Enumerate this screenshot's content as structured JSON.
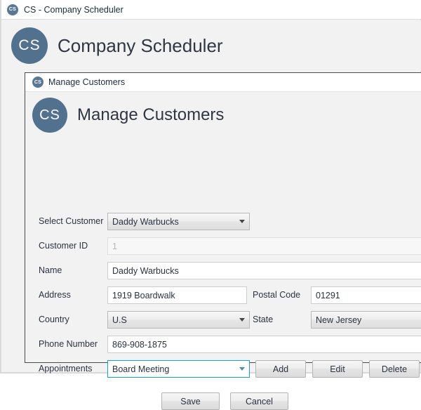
{
  "app_window": {
    "titlebar": {
      "icon": "cs-app-icon",
      "icon_text": "CS",
      "title": "CS - Company Scheduler"
    },
    "header": {
      "avatar_text": "CS",
      "heading": "Company Scheduler"
    }
  },
  "dialog": {
    "titlebar": {
      "icon_text": "CS",
      "title": "Manage Customers"
    },
    "header": {
      "avatar_text": "CS",
      "heading": "Manage Customers"
    },
    "form": {
      "select_customer": {
        "label": "Select Customer",
        "value": "Daddy Warbucks"
      },
      "customer_id": {
        "label": "Customer ID",
        "value": "1",
        "placeholder": ""
      },
      "name": {
        "label": "Name",
        "value": "Daddy Warbucks",
        "placeholder": ""
      },
      "address": {
        "label": "Address",
        "value": "1919 Boardwalk",
        "placeholder": ""
      },
      "postal_code": {
        "label": "Postal Code",
        "value": "01291",
        "placeholder": ""
      },
      "country": {
        "label": "Country",
        "value": "U.S"
      },
      "state": {
        "label": "State",
        "value": "New Jersey"
      },
      "phone_number": {
        "label": "Phone Number",
        "value": "869-908-1875",
        "placeholder": ""
      },
      "appointments": {
        "label": "Appointments",
        "value": "Board Meeting"
      }
    },
    "appointment_actions": {
      "add": "Add",
      "edit": "Edit",
      "delete": "Delete"
    },
    "dialog_actions": {
      "save": "Save",
      "cancel": "Cancel"
    }
  },
  "colors": {
    "avatar": "#52718f",
    "focus_border": "#14a0de",
    "window_background": "#f2f2f2",
    "text": "#2b3240"
  }
}
